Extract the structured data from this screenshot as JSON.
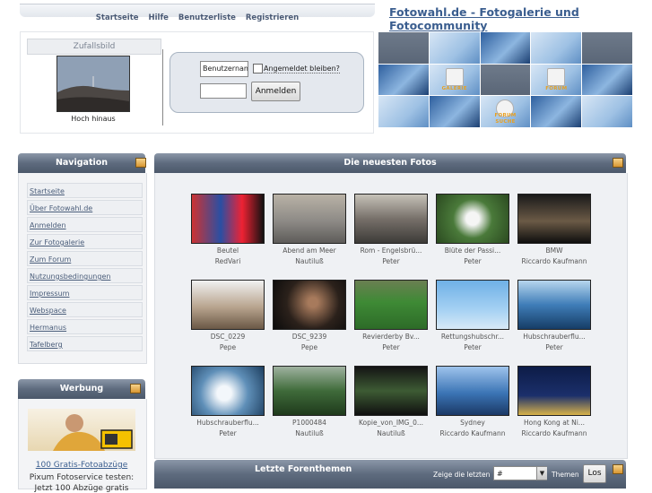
{
  "topnav": {
    "links": [
      "Startseite",
      "Hilfe",
      "Benutzerliste",
      "Registrieren"
    ]
  },
  "site_title": "Fotowahl.de - Fotogalerie und Fotocommunity",
  "random_image": {
    "heading": "Zufallsbild",
    "caption": "Hoch hinaus"
  },
  "login": {
    "username_value": "Benutzernam",
    "remember_label": "Angemeldet bleiben?",
    "password_value": "",
    "submit_label": "Anmelden"
  },
  "mosaic": {
    "labels": {
      "galerie": "GALERIE",
      "forum": "FORUM",
      "forum_suche_1": "FORUM",
      "forum_suche_2": "SUCHE"
    }
  },
  "navigation": {
    "title": "Navigation",
    "items": [
      "Startseite",
      "Über Fotowahl.de",
      "Anmelden",
      "Zur Fotogalerie",
      "Zum Forum",
      "Nutzungsbedingungen",
      "Impressum",
      "Webspace",
      "Hermanus",
      "Tafelberg"
    ]
  },
  "ad": {
    "title": "Werbung",
    "link": "100 Gratis-Fotoabzüge",
    "text": "Pixum Fotoservice testen:",
    "text2": "Jetzt 100 Abzüge gratis"
  },
  "photos": {
    "title": "Die neuesten Fotos",
    "items": [
      {
        "title": "Beutel",
        "user": "RedVari"
      },
      {
        "title": "Abend am Meer",
        "user": "Nautiluß"
      },
      {
        "title": "Rom - Engelsbrü...",
        "user": "Peter"
      },
      {
        "title": "Blüte der Passi...",
        "user": "Peter"
      },
      {
        "title": "BMW",
        "user": "Riccardo Kaufmann"
      },
      {
        "title": "DSC_0229",
        "user": "Pepe"
      },
      {
        "title": "DSC_9239",
        "user": "Pepe"
      },
      {
        "title": "Revierderby Bv...",
        "user": "Peter"
      },
      {
        "title": "Rettungshubschr...",
        "user": "Peter"
      },
      {
        "title": "Hubschrauberflu...",
        "user": "Peter"
      },
      {
        "title": "Hubschrauberflu...",
        "user": "Peter"
      },
      {
        "title": "P1000484",
        "user": "Nautiluß"
      },
      {
        "title": "Kopie_von_IMG_0...",
        "user": "Nautiluß"
      },
      {
        "title": "Sydney",
        "user": "Riccardo Kaufmann"
      },
      {
        "title": "Hong Kong at Ni...",
        "user": "Riccardo Kaufmann"
      }
    ]
  },
  "forum": {
    "title": "Letzte Forenthemen",
    "show_label": "Zeige die letzten",
    "select_value": "#",
    "themen_label": "Themen",
    "button_label": "Los"
  },
  "colors": {
    "accent": "#3b5e8f",
    "header_bar": "#5e6b7e",
    "panel_bg": "#eff1f4"
  }
}
